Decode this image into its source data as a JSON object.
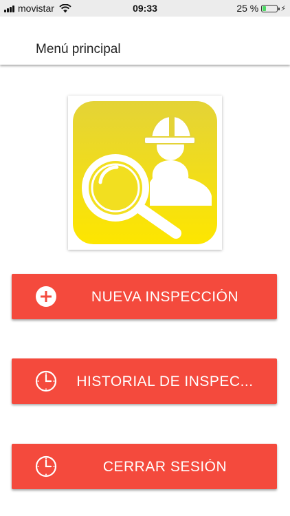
{
  "status_bar": {
    "carrier": "movistar",
    "time": "09:33",
    "battery_percent": "25 %",
    "battery_level": 0.25,
    "icons": [
      "signal-icon",
      "wifi-icon",
      "battery-icon",
      "charging-bolt-icon"
    ]
  },
  "header": {
    "title": "Menú principal"
  },
  "logo": {
    "icon": "worker-inspection-logo",
    "colors": {
      "top": "#e4d337",
      "bottom": "#fde600",
      "fg": "#ffffff"
    }
  },
  "buttons": [
    {
      "label": "NUEVA INSPECCIÓN",
      "icon": "plus-circle-icon"
    },
    {
      "label": "HISTORIAL DE INSPEC...",
      "icon": "clock-icon"
    },
    {
      "label": "CERRAR SESIÓN",
      "icon": "clock-icon"
    }
  ],
  "colors": {
    "button_bg": "#f44a3d",
    "button_text": "#ffffff",
    "status_bar_bg": "#ececec"
  }
}
